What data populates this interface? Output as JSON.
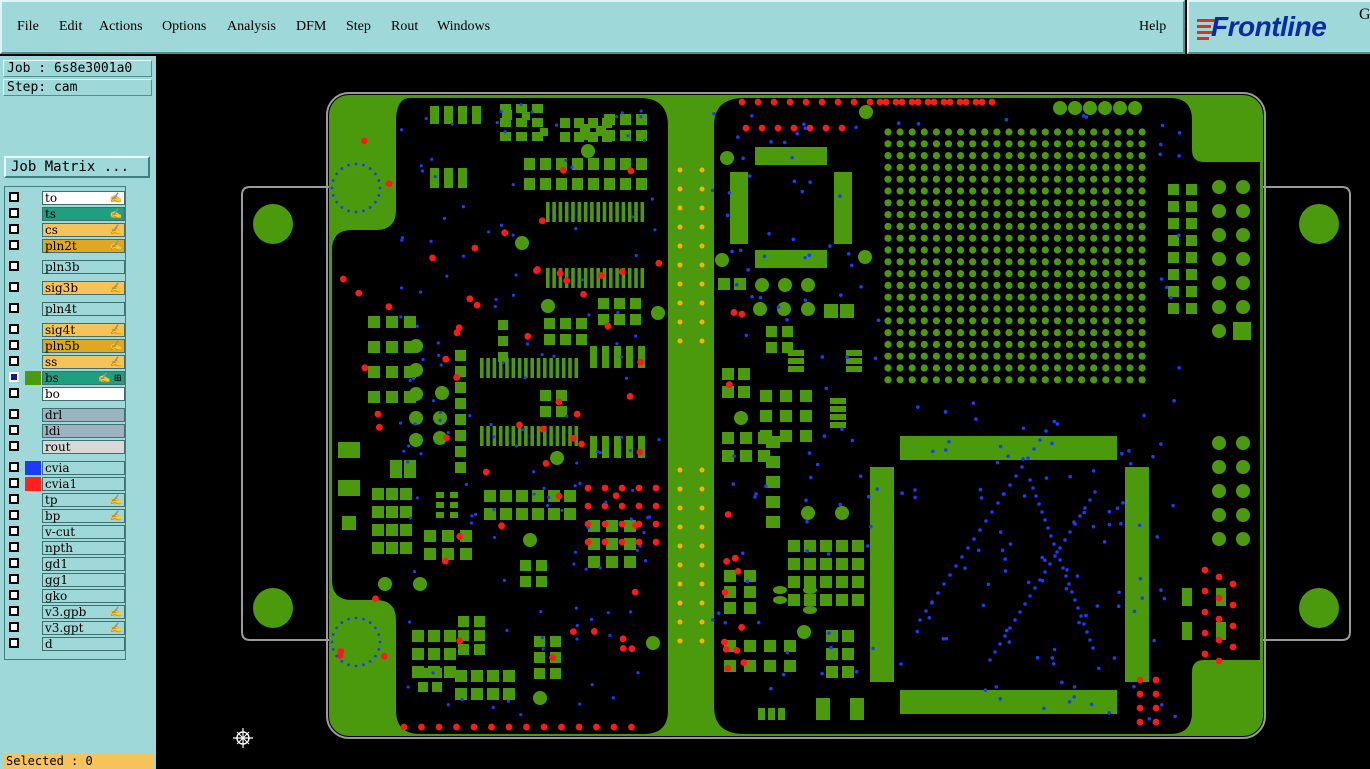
{
  "menubar": {
    "items": [
      {
        "label": "File"
      },
      {
        "label": "Edit"
      },
      {
        "label": "Actions"
      },
      {
        "label": "Options"
      },
      {
        "label": "Analysis"
      },
      {
        "label": "DFM"
      },
      {
        "label": "Step"
      },
      {
        "label": "Rout"
      },
      {
        "label": "Windows"
      }
    ],
    "help": "Help"
  },
  "logo": {
    "text": "Frontline",
    "corner": "G"
  },
  "job": {
    "label": "Job : 6s8e3001a0",
    "step": "Step: cam",
    "matrix_button": "Job Matrix ..."
  },
  "layers": [
    {
      "name": "to",
      "color": "#ffffff",
      "flag": "✍",
      "group": 0
    },
    {
      "name": "ts",
      "color": "#1f9f7f",
      "flag": "✍",
      "group": 0
    },
    {
      "name": "cs",
      "color": "#f6c35a",
      "flag": "✍",
      "group": 0
    },
    {
      "name": "pln2t",
      "color": "#e0a820",
      "flag": "✍",
      "group": 0
    },
    {
      "name": "pln3b",
      "color": "#9fd8d8",
      "flag": "",
      "group": 1
    },
    {
      "name": "sig3b",
      "color": "#f6c35a",
      "flag": "✍",
      "group": 2
    },
    {
      "name": "pln4t",
      "color": "#9fd8d8",
      "flag": "",
      "group": 3
    },
    {
      "name": "sig4t",
      "color": "#f6c35a",
      "flag": "✍",
      "group": 4
    },
    {
      "name": "pln5b",
      "color": "#e0a820",
      "flag": "✍",
      "group": 4
    },
    {
      "name": "ss",
      "color": "#f6c35a",
      "flag": "✍",
      "group": 4
    },
    {
      "name": "bs",
      "color": "#1f9f7f",
      "flag": "✍ ⊞",
      "group": 4,
      "active": true
    },
    {
      "name": "bo",
      "color": "#ffffff",
      "flag": "",
      "group": 4
    },
    {
      "name": "drl",
      "color": "#9cb4c0",
      "flag": "",
      "group": 5
    },
    {
      "name": "ldi",
      "color": "#9cb4c0",
      "flag": "",
      "group": 5
    },
    {
      "name": "rout",
      "color": "#d8d8d8",
      "flag": "",
      "group": 5
    },
    {
      "name": "cvia",
      "color": "#9fd8d8",
      "flag": "",
      "group": 6,
      "swatch": "#1a3cff"
    },
    {
      "name": "cvia1",
      "color": "#9fd8d8",
      "flag": "",
      "group": 6,
      "swatch": "#ff2020"
    },
    {
      "name": "tp",
      "color": "#9fd8d8",
      "flag": "✍",
      "group": 6
    },
    {
      "name": "bp",
      "color": "#9fd8d8",
      "flag": "✍",
      "group": 6
    },
    {
      "name": "v-cut",
      "color": "#9fd8d8",
      "flag": "",
      "group": 6
    },
    {
      "name": "npth",
      "color": "#9fd8d8",
      "flag": "",
      "group": 6
    },
    {
      "name": "gd1",
      "color": "#9fd8d8",
      "flag": "",
      "group": 6
    },
    {
      "name": "gg1",
      "color": "#9fd8d8",
      "flag": "",
      "group": 6
    },
    {
      "name": "gko",
      "color": "#9fd8d8",
      "flag": "",
      "group": 6
    },
    {
      "name": "v3.gpb",
      "color": "#9fd8d8",
      "flag": "✍",
      "group": 6
    },
    {
      "name": "v3.gpt",
      "color": "#9fd8d8",
      "flag": "✍",
      "group": 6
    },
    {
      "name": "d",
      "color": "#9fd8d8",
      "flag": "",
      "group": 6
    }
  ],
  "status": {
    "selected": "Selected : 0"
  },
  "colors": {
    "board": "#4b9a0e",
    "via_blue": "#1a3cff",
    "via_red": "#ff1a1a",
    "panel": "#9fd8d8",
    "outline": "#9a9a9a"
  }
}
